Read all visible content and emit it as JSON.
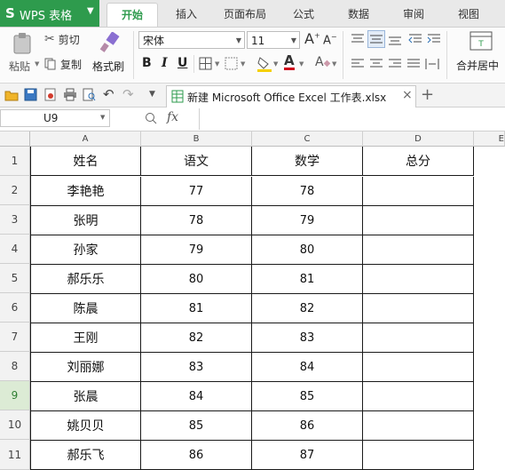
{
  "app": {
    "logo_text": "WPS 表格",
    "logo_mark": "S",
    "accent_color": "#2e9b4d"
  },
  "tabs": [
    {
      "label": "开始",
      "active": true
    },
    {
      "label": "插入",
      "active": false
    },
    {
      "label": "页面布局",
      "active": false
    },
    {
      "label": "公式",
      "active": false
    },
    {
      "label": "数据",
      "active": false
    },
    {
      "label": "审阅",
      "active": false
    },
    {
      "label": "视图",
      "active": false
    }
  ],
  "ribbon": {
    "cut": "剪切",
    "paste": "粘贴",
    "copy": "复制",
    "format_painter": "格式刷",
    "font_name": "宋体",
    "font_size": "11",
    "merge_center": "合并居中",
    "bold": "B",
    "italic": "I",
    "underline": "U",
    "font_color_glyph": "A",
    "grow_font": "A",
    "shrink_font": "A",
    "clear_glyph": "A"
  },
  "file_tab": {
    "name": "新建 Microsoft Office Excel 工作表.xlsx",
    "close": "×",
    "add": "+"
  },
  "formula_bar": {
    "name_box": "U9",
    "fx": "fx"
  },
  "columns": [
    "A",
    "B",
    "C",
    "D",
    "E"
  ],
  "rows": [
    "1",
    "2",
    "3",
    "4",
    "5",
    "6",
    "7",
    "8",
    "9",
    "10",
    "11"
  ],
  "selected_row": "9",
  "table": {
    "headers": [
      "姓名",
      "语文",
      "数学",
      "总分"
    ],
    "data": [
      [
        "李艳艳",
        "77",
        "78",
        ""
      ],
      [
        "张明",
        "78",
        "79",
        ""
      ],
      [
        "孙家",
        "79",
        "80",
        ""
      ],
      [
        "郝乐乐",
        "80",
        "81",
        ""
      ],
      [
        "陈晨",
        "81",
        "82",
        ""
      ],
      [
        "王刚",
        "82",
        "83",
        ""
      ],
      [
        "刘丽娜",
        "83",
        "84",
        ""
      ],
      [
        "张晨",
        "84",
        "85",
        ""
      ],
      [
        "姚贝贝",
        "85",
        "86",
        ""
      ],
      [
        "郝乐飞",
        "86",
        "87",
        ""
      ]
    ]
  }
}
